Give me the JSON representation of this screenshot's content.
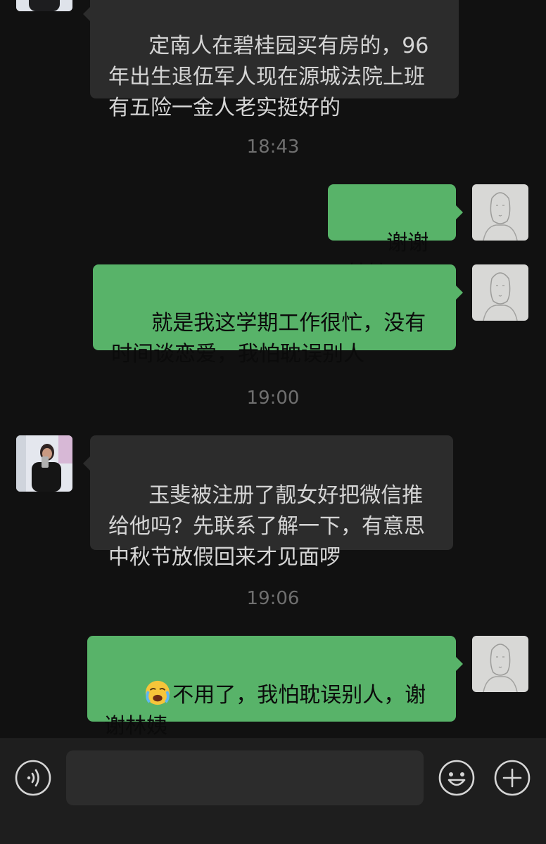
{
  "messages": [
    {
      "text": "定南人在碧桂园买有房的，96年出生退伍军人现在源城法院上班有五险一金人老实挺好的"
    },
    {
      "text": "谢谢林姨"
    },
    {
      "text": "就是我这学期工作很忙，没有时间谈恋爱，我怕耽误别人"
    },
    {
      "text": "玉斐被注册了靓女好把微信推给他吗？先联系了解一下，有意思中秋节放假回来才见面啰"
    },
    {
      "text": "不用了，我怕耽误别人，谢谢林姨",
      "emoji": "crying-face-icon"
    }
  ],
  "timestamps": [
    "18:43",
    "19:00",
    "19:06"
  ],
  "input": {
    "value": ""
  },
  "colors": {
    "background": "#111111",
    "incoming_bubble": "#2c2c2c",
    "outgoing_bubble": "#58b369",
    "timestamp": "#6f6f6f",
    "toolbar": "#1e1e1e"
  },
  "icons": {
    "voice": "voice-icon",
    "emoji": "emoji-icon",
    "plus": "plus-icon"
  }
}
